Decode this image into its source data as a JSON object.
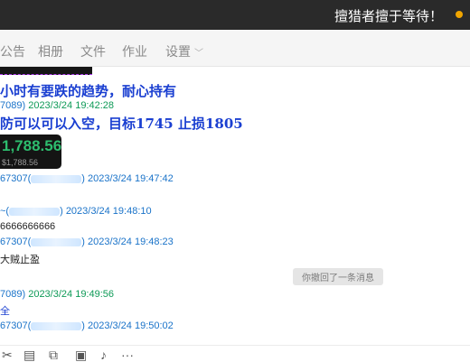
{
  "window": {
    "title": "擅猎者擅于等待！"
  },
  "tabs": [
    "公告",
    "相册",
    "文件",
    "作业",
    "设置"
  ],
  "messages": {
    "line1": "小时有要跌的趋势，耐心持有",
    "meta1_id": "7089)",
    "meta1_time": "2023/3/24 19:42:28",
    "line2": "防可以可以入空，目标1745 止损1805",
    "price_main": "1,788.56",
    "price_sub": "$1,788.56",
    "meta2_id": "67307(",
    "meta2_time": ") 2023/3/24 19:47:42",
    "meta3_prefix": "~(",
    "meta3_time": ") 2023/3/24 19:48:10",
    "text3": "6666666666",
    "meta4_id": "67307(",
    "meta4_time": ") 2023/3/24 19:48:23",
    "text4": "大贼止盈",
    "recall": "你撤回了一条消息",
    "meta5_id": "7089)",
    "meta5_time": "2023/3/24 19:49:56",
    "text5": "全",
    "meta6_id": "67307(",
    "meta6_time": ") 2023/3/24 19:50:02"
  },
  "colors": {
    "accent_blue": "#1a3fd1",
    "price_green": "#2dbd6e",
    "link_blue": "#1a73c9"
  },
  "toolbar_icons": [
    "scissors-icon",
    "folder-icon",
    "screenshot-icon",
    "image-icon",
    "bell-icon",
    "more-icon"
  ]
}
